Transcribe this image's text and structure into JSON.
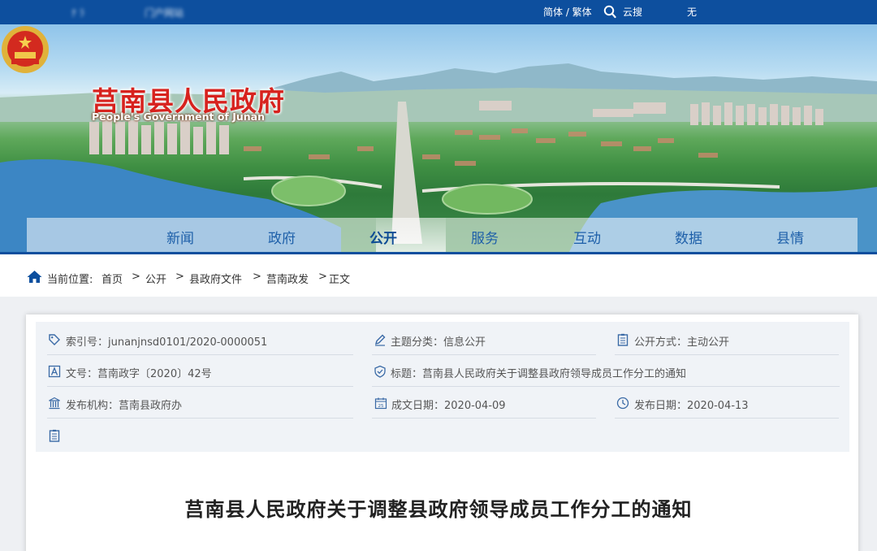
{
  "topbar": {
    "left_text_1": "ﾅ   ﾗ",
    "left_text_2": "门户网站",
    "lang": "简体 / 繁体",
    "search_label": "云搜",
    "right_text": "无"
  },
  "brand": {
    "name_cn": "莒南县人民政府",
    "name_en": "People's Government of Junan"
  },
  "nav": {
    "items": [
      "新闻",
      "政府",
      "公开",
      "服务",
      "互动",
      "数据",
      "县情"
    ],
    "active": "公开"
  },
  "breadcrumb": {
    "label": "当前位置:",
    "items": [
      "首页",
      "公开",
      "县政府文件",
      "莒南政发",
      "正文"
    ],
    "separator": ">"
  },
  "meta": {
    "index_no": "索引号：junanjnsd0101/2020-0000051",
    "topic": "主题分类：信息公开",
    "open_mode": "公开方式：主动公开",
    "doc_no": "文号：莒南政字〔2020〕42号",
    "title": "标题：莒南县人民政府关于调整县政府领导成员工作分工的通知",
    "issuer": "发布机构：莒南县政府办",
    "created": "成文日期：2020-04-09",
    "published": "发布日期：2020-04-13"
  },
  "article": {
    "title": "莒南县人民政府关于调整县政府领导成员工作分工的通知"
  },
  "colors": {
    "brand_blue": "#0d4f9e",
    "brand_red": "#d7221e",
    "nav_text": "#1d5fa9"
  },
  "icons": [
    "search-icon",
    "home-icon",
    "tag-icon",
    "pencil-icon",
    "document-icon",
    "letter-a-icon",
    "shield-check-icon",
    "building-icon",
    "calendar-icon",
    "clock-icon"
  ]
}
